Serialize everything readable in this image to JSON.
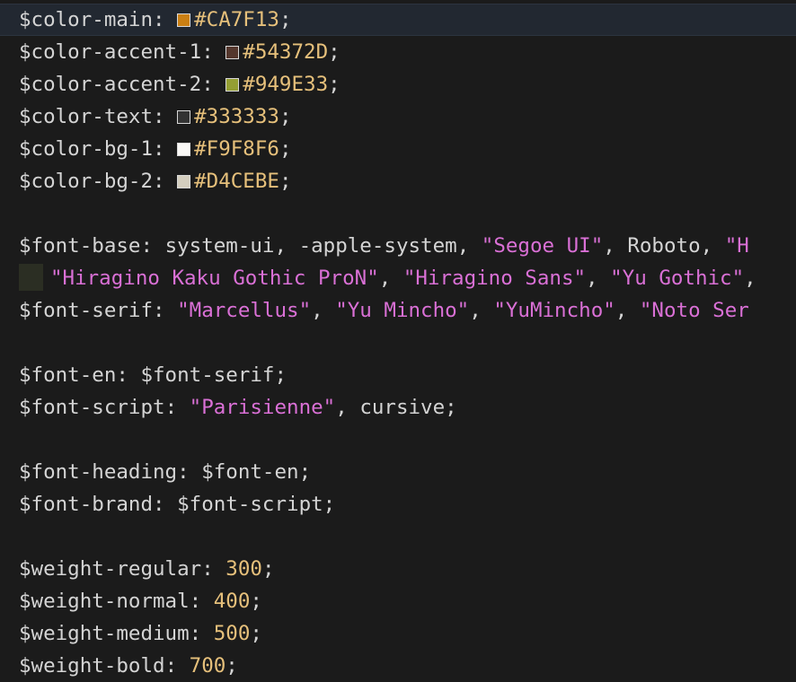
{
  "editor": {
    "lines": [
      {
        "kind": "color",
        "name": "$color-main",
        "hex": "#CA7F13",
        "swatch": "#CA7F13",
        "current": true
      },
      {
        "kind": "color",
        "name": "$color-accent-1",
        "hex": "#54372D",
        "swatch": "#54372D"
      },
      {
        "kind": "color",
        "name": "$color-accent-2",
        "hex": "#949E33",
        "swatch": "#949E33"
      },
      {
        "kind": "color",
        "name": "$color-text",
        "hex": "#333333",
        "swatch": "#333333"
      },
      {
        "kind": "color",
        "name": "$color-bg-1",
        "hex": "#F9F8F6",
        "swatch": "#F9F8F6"
      },
      {
        "kind": "color",
        "name": "$color-bg-2",
        "hex": "#D4CEBE",
        "swatch": "#D4CEBE"
      },
      {
        "kind": "blank"
      },
      {
        "kind": "tokens",
        "tokens": [
          {
            "t": "var",
            "v": "$font-base"
          },
          {
            "t": "punc",
            "v": ": "
          },
          {
            "t": "kw",
            "v": "system-ui"
          },
          {
            "t": "punc",
            "v": ", "
          },
          {
            "t": "kw",
            "v": "-apple-system"
          },
          {
            "t": "punc",
            "v": ", "
          },
          {
            "t": "str",
            "v": "\"Segoe UI\""
          },
          {
            "t": "punc",
            "v": ", "
          },
          {
            "t": "kw",
            "v": "Roboto"
          },
          {
            "t": "punc",
            "v": ", "
          },
          {
            "t": "str",
            "v": "\"H"
          }
        ]
      },
      {
        "kind": "tokens",
        "indent": true,
        "tokens": [
          {
            "t": "str",
            "v": "\"Hiragino Kaku Gothic ProN\""
          },
          {
            "t": "punc",
            "v": ", "
          },
          {
            "t": "str",
            "v": "\"Hiragino Sans\""
          },
          {
            "t": "punc",
            "v": ", "
          },
          {
            "t": "str",
            "v": "\"Yu Gothic\""
          },
          {
            "t": "punc",
            "v": ","
          }
        ]
      },
      {
        "kind": "tokens",
        "tokens": [
          {
            "t": "var",
            "v": "$font-serif"
          },
          {
            "t": "punc",
            "v": ": "
          },
          {
            "t": "str",
            "v": "\"Marcellus\""
          },
          {
            "t": "punc",
            "v": ", "
          },
          {
            "t": "str",
            "v": "\"Yu Mincho\""
          },
          {
            "t": "punc",
            "v": ", "
          },
          {
            "t": "str",
            "v": "\"YuMincho\""
          },
          {
            "t": "punc",
            "v": ", "
          },
          {
            "t": "str",
            "v": "\"Noto Ser"
          }
        ]
      },
      {
        "kind": "blank"
      },
      {
        "kind": "tokens",
        "tokens": [
          {
            "t": "var",
            "v": "$font-en"
          },
          {
            "t": "punc",
            "v": ": "
          },
          {
            "t": "var",
            "v": "$font-serif"
          },
          {
            "t": "punc",
            "v": ";"
          }
        ]
      },
      {
        "kind": "tokens",
        "tokens": [
          {
            "t": "var",
            "v": "$font-script"
          },
          {
            "t": "punc",
            "v": ": "
          },
          {
            "t": "str",
            "v": "\"Parisienne\""
          },
          {
            "t": "punc",
            "v": ", "
          },
          {
            "t": "kw",
            "v": "cursive"
          },
          {
            "t": "punc",
            "v": ";"
          }
        ]
      },
      {
        "kind": "blank"
      },
      {
        "kind": "tokens",
        "tokens": [
          {
            "t": "var",
            "v": "$font-heading"
          },
          {
            "t": "punc",
            "v": ": "
          },
          {
            "t": "var",
            "v": "$font-en"
          },
          {
            "t": "punc",
            "v": ";"
          }
        ]
      },
      {
        "kind": "tokens",
        "tokens": [
          {
            "t": "var",
            "v": "$font-brand"
          },
          {
            "t": "punc",
            "v": ": "
          },
          {
            "t": "var",
            "v": "$font-script"
          },
          {
            "t": "punc",
            "v": ";"
          }
        ]
      },
      {
        "kind": "blank"
      },
      {
        "kind": "tokens",
        "tokens": [
          {
            "t": "var",
            "v": "$weight-regular"
          },
          {
            "t": "punc",
            "v": ": "
          },
          {
            "t": "num",
            "v": "300"
          },
          {
            "t": "punc",
            "v": ";"
          }
        ]
      },
      {
        "kind": "tokens",
        "tokens": [
          {
            "t": "var",
            "v": "$weight-normal"
          },
          {
            "t": "punc",
            "v": ": "
          },
          {
            "t": "num",
            "v": "400"
          },
          {
            "t": "punc",
            "v": ";"
          }
        ]
      },
      {
        "kind": "tokens",
        "tokens": [
          {
            "t": "var",
            "v": "$weight-medium"
          },
          {
            "t": "punc",
            "v": ": "
          },
          {
            "t": "num",
            "v": "500"
          },
          {
            "t": "punc",
            "v": ";"
          }
        ]
      },
      {
        "kind": "tokens",
        "tokens": [
          {
            "t": "var",
            "v": "$weight-bold"
          },
          {
            "t": "punc",
            "v": ": "
          },
          {
            "t": "num",
            "v": "700"
          },
          {
            "t": "punc",
            "v": ";"
          }
        ]
      }
    ]
  }
}
